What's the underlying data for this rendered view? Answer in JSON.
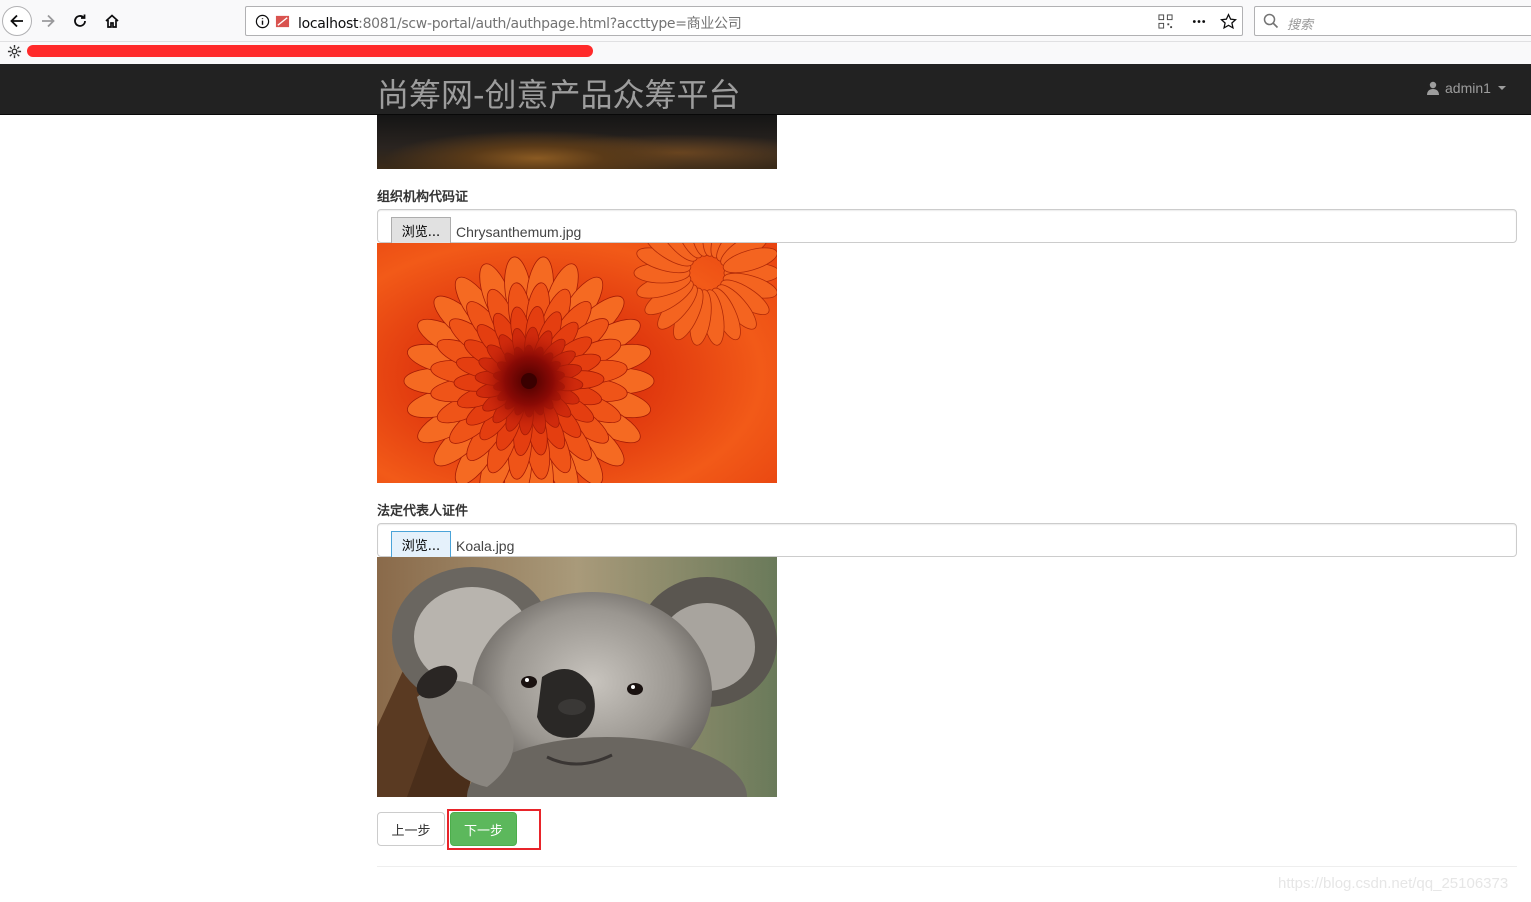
{
  "browser": {
    "url_host": "localhost",
    "url_rest": ":8081/scw-portal/auth/authpage.html?accttype=商业公司",
    "search_placeholder": "搜索"
  },
  "navbar": {
    "brand": "尚筹网-创意产品众筹平台",
    "user": "admin1"
  },
  "form": {
    "org_code_label": "组织机构代码证",
    "org_code_browse": "浏览...",
    "org_code_file": "Chrysanthemum.jpg",
    "legal_rep_label": "法定代表人证件",
    "legal_rep_browse": "浏览...",
    "legal_rep_file": "Koala.jpg"
  },
  "buttons": {
    "prev": "上一步",
    "next": "下一步"
  },
  "watermark": "https://blog.csdn.net/qq_25106373",
  "colors": {
    "navbar_bg": "#222222",
    "next_button": "#5cb85c",
    "highlight": "#e8242a"
  }
}
